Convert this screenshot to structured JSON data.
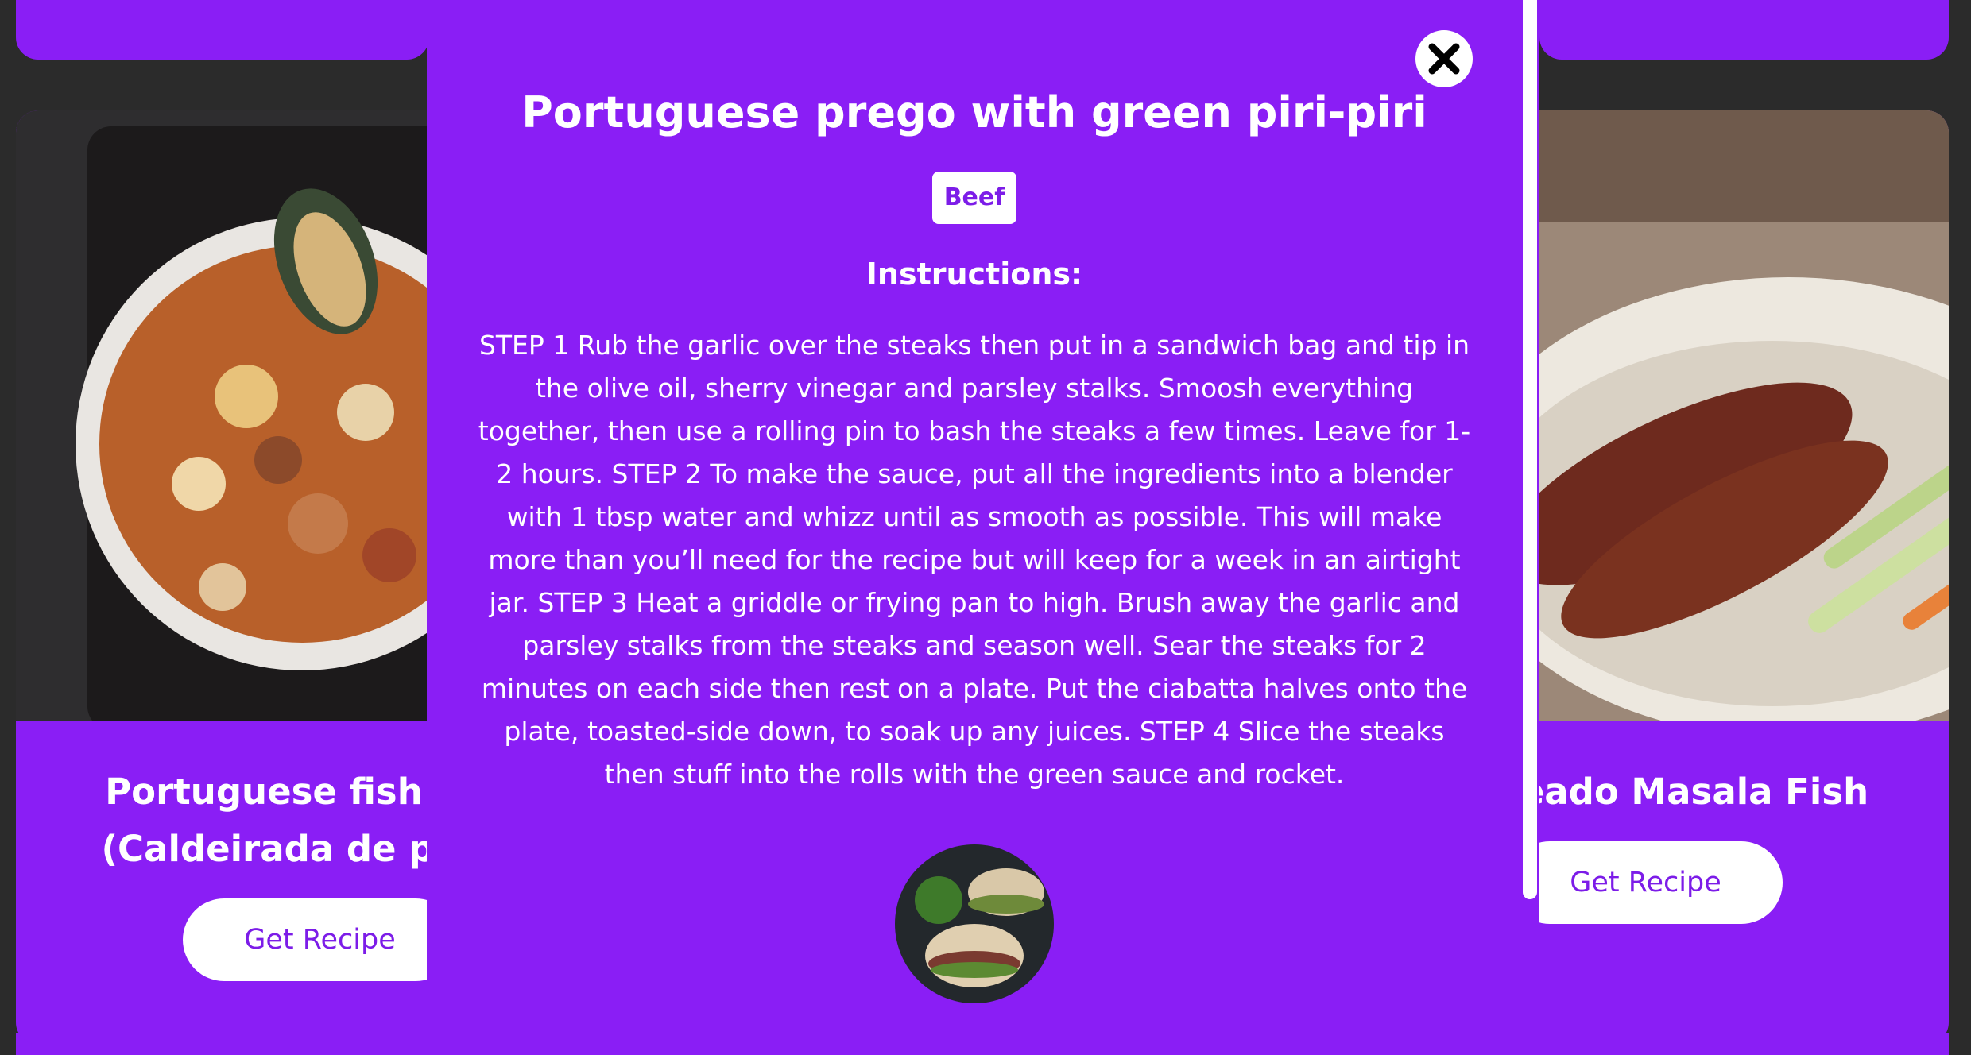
{
  "cards": {
    "left": {
      "title": "Portuguese fish stew (Caldeirada de peixe)",
      "button_label": "Get Recipe"
    },
    "right": {
      "title": "Recheado Masala Fish",
      "button_label": "Get Recipe"
    }
  },
  "modal": {
    "title": "Portuguese prego with green piri-piri",
    "category_tag": "Beef",
    "instructions_heading": "Instructions:",
    "instructions": "STEP 1 Rub the garlic over the steaks then put in a sandwich bag and tip in the olive oil, sherry vinegar and parsley stalks. Smoosh everything together, then use a rolling pin to bash the steaks a few times. Leave for 1-2 hours. STEP 2 To make the sauce, put all the ingredients into a blender with 1 tbsp water and whizz until as smooth as possible. This will make more than you’ll need for the recipe but will keep for a week in an airtight jar. STEP 3 Heat a griddle or frying pan to high. Brush away the garlic and parsley stalks from the steaks and season well. Sear the steaks for 2 minutes on each side then rest on a plate. Put the ciabatta halves onto the plate, toasted-side down, to soak up any juices. STEP 4 Slice the steaks then stuff into the rolls with the green sauce and rocket.",
    "close_icon": "close-icon"
  },
  "colors": {
    "accent": "#8a1ef5",
    "button_text": "#7c1ce8",
    "background": "#2b2b2b"
  }
}
